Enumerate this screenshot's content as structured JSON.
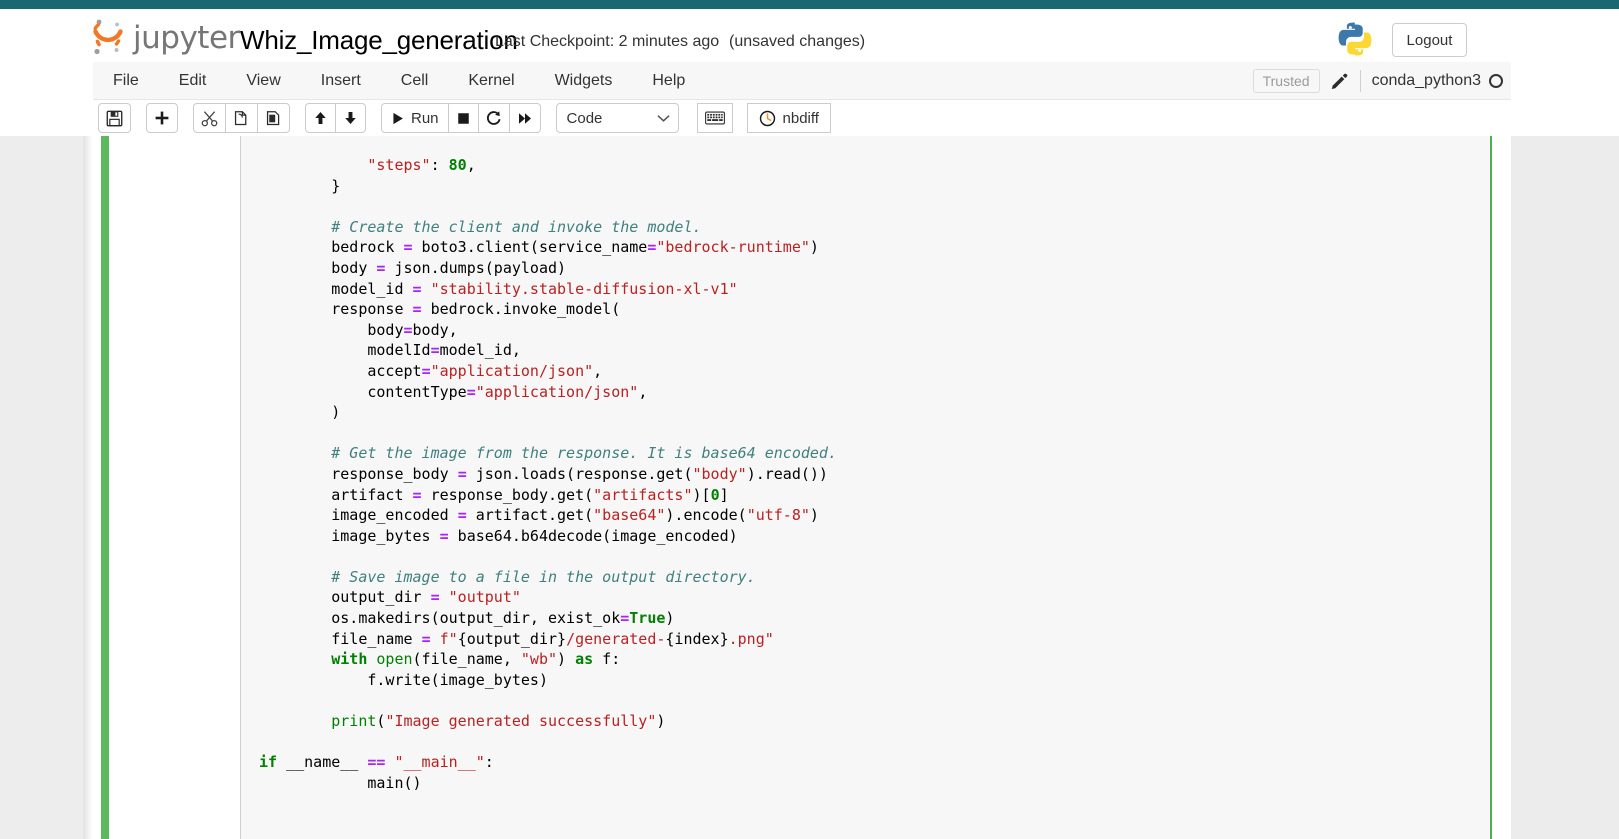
{
  "window": {
    "accent_teal": "#1a6872",
    "cell_select_green": "#5cb85c"
  },
  "header": {
    "logo_word": "jupyter",
    "logo_icon": "jupyter-logo",
    "notebook_title": "Whiz_Image_generation",
    "checkpoint_label": "Last Checkpoint: 2 minutes ago",
    "unsaved_label": "(unsaved changes)",
    "python_logo_icon": "python-logo",
    "logout_label": "Logout"
  },
  "menubar": {
    "items": [
      {
        "label": "File"
      },
      {
        "label": "Edit"
      },
      {
        "label": "View"
      },
      {
        "label": "Insert"
      },
      {
        "label": "Cell"
      },
      {
        "label": "Kernel"
      },
      {
        "label": "Widgets"
      },
      {
        "label": "Help"
      }
    ],
    "trusted_label": "Trusted",
    "edit_icon": "pencil-icon",
    "kernel_name": "conda_python3",
    "kernel_status_icon": "kernel-idle-circle-icon"
  },
  "toolbar": {
    "save_label": "",
    "save_icon": "save-floppy-icon",
    "insert_icon": "plus-icon",
    "cut_icon": "scissors-icon",
    "copy_icon": "copy-icon",
    "paste_icon": "paste-icon",
    "move_up_icon": "arrow-up-icon",
    "move_down_icon": "arrow-down-icon",
    "run_label": "Run",
    "run_icon": "play-icon",
    "stop_icon": "stop-square-icon",
    "restart_icon": "restart-circle-arrow-icon",
    "restart_run_all_icon": "fast-forward-icon",
    "cell_type_value": "Code",
    "cell_type_caret_icon": "chevron-down-icon",
    "keyboard_icon": "keyboard-icon",
    "nbdiff_label": "nbdiff",
    "nbdiff_icon": "clock-icon"
  },
  "notebook": {
    "cell": {
      "type": "code",
      "prompt": "",
      "language": "python",
      "lines": [
        [
          {
            "t": "    ",
            "c": "nm"
          },
          {
            "t": "\"steps\"",
            "c": "str"
          },
          {
            "t": ": ",
            "c": "nm"
          },
          {
            "t": "80",
            "c": "num"
          },
          {
            "t": ",",
            "c": "nm"
          }
        ],
        [
          {
            "t": "}",
            "c": "nm"
          }
        ],
        [
          {
            "t": "",
            "c": "nm"
          }
        ],
        [
          {
            "t": "# Create the client and invoke the model.",
            "c": "com"
          }
        ],
        [
          {
            "t": "bedrock ",
            "c": "nm"
          },
          {
            "t": "=",
            "c": "op"
          },
          {
            "t": " boto3.client(service_name",
            "c": "nm"
          },
          {
            "t": "=",
            "c": "op"
          },
          {
            "t": "\"bedrock-runtime\"",
            "c": "str"
          },
          {
            "t": ")",
            "c": "nm"
          }
        ],
        [
          {
            "t": "body ",
            "c": "nm"
          },
          {
            "t": "=",
            "c": "op"
          },
          {
            "t": " json.dumps(payload)",
            "c": "nm"
          }
        ],
        [
          {
            "t": "model_id ",
            "c": "nm"
          },
          {
            "t": "=",
            "c": "op"
          },
          {
            "t": " ",
            "c": "nm"
          },
          {
            "t": "\"stability.stable-diffusion-xl-v1\"",
            "c": "str"
          }
        ],
        [
          {
            "t": "response ",
            "c": "nm"
          },
          {
            "t": "=",
            "c": "op"
          },
          {
            "t": " bedrock.invoke_model(",
            "c": "nm"
          }
        ],
        [
          {
            "t": "    body",
            "c": "nm"
          },
          {
            "t": "=",
            "c": "op"
          },
          {
            "t": "body,",
            "c": "nm"
          }
        ],
        [
          {
            "t": "    modelId",
            "c": "nm"
          },
          {
            "t": "=",
            "c": "op"
          },
          {
            "t": "model_id,",
            "c": "nm"
          }
        ],
        [
          {
            "t": "    accept",
            "c": "nm"
          },
          {
            "t": "=",
            "c": "op"
          },
          {
            "t": "\"application/json\"",
            "c": "str"
          },
          {
            "t": ",",
            "c": "nm"
          }
        ],
        [
          {
            "t": "    contentType",
            "c": "nm"
          },
          {
            "t": "=",
            "c": "op"
          },
          {
            "t": "\"application/json\"",
            "c": "str"
          },
          {
            "t": ",",
            "c": "nm"
          }
        ],
        [
          {
            "t": ")",
            "c": "nm"
          }
        ],
        [
          {
            "t": "",
            "c": "nm"
          }
        ],
        [
          {
            "t": "# Get the image from the response. It is base64 encoded.",
            "c": "com"
          }
        ],
        [
          {
            "t": "response_body ",
            "c": "nm"
          },
          {
            "t": "=",
            "c": "op"
          },
          {
            "t": " json.loads(response.get(",
            "c": "nm"
          },
          {
            "t": "\"body\"",
            "c": "str"
          },
          {
            "t": ").read())",
            "c": "nm"
          }
        ],
        [
          {
            "t": "artifact ",
            "c": "nm"
          },
          {
            "t": "=",
            "c": "op"
          },
          {
            "t": " response_body.get(",
            "c": "nm"
          },
          {
            "t": "\"artifacts\"",
            "c": "str"
          },
          {
            "t": ")[",
            "c": "nm"
          },
          {
            "t": "0",
            "c": "num"
          },
          {
            "t": "]",
            "c": "nm"
          }
        ],
        [
          {
            "t": "image_encoded ",
            "c": "nm"
          },
          {
            "t": "=",
            "c": "op"
          },
          {
            "t": " artifact.get(",
            "c": "nm"
          },
          {
            "t": "\"base64\"",
            "c": "str"
          },
          {
            "t": ").encode(",
            "c": "nm"
          },
          {
            "t": "\"utf-8\"",
            "c": "str"
          },
          {
            "t": ")",
            "c": "nm"
          }
        ],
        [
          {
            "t": "image_bytes ",
            "c": "nm"
          },
          {
            "t": "=",
            "c": "op"
          },
          {
            "t": " base64.b64decode(image_encoded)",
            "c": "nm"
          }
        ],
        [
          {
            "t": "",
            "c": "nm"
          }
        ],
        [
          {
            "t": "# Save image to a file in the output directory.",
            "c": "com"
          }
        ],
        [
          {
            "t": "output_dir ",
            "c": "nm"
          },
          {
            "t": "=",
            "c": "op"
          },
          {
            "t": " ",
            "c": "nm"
          },
          {
            "t": "\"output\"",
            "c": "str"
          }
        ],
        [
          {
            "t": "os.makedirs(output_dir, exist_ok",
            "c": "nm"
          },
          {
            "t": "=",
            "c": "op"
          },
          {
            "t": "True",
            "c": "kw"
          },
          {
            "t": ")",
            "c": "nm"
          }
        ],
        [
          {
            "t": "file_name ",
            "c": "nm"
          },
          {
            "t": "=",
            "c": "op"
          },
          {
            "t": " ",
            "c": "nm"
          },
          {
            "t": "f\"",
            "c": "str"
          },
          {
            "t": "{output_dir}",
            "c": "nm"
          },
          {
            "t": "/generated-",
            "c": "str"
          },
          {
            "t": "{index}",
            "c": "nm"
          },
          {
            "t": ".png\"",
            "c": "str"
          }
        ],
        [
          {
            "t": "with",
            "c": "kw"
          },
          {
            "t": " ",
            "c": "nm"
          },
          {
            "t": "open",
            "c": "bi"
          },
          {
            "t": "(file_name, ",
            "c": "nm"
          },
          {
            "t": "\"wb\"",
            "c": "str"
          },
          {
            "t": ") ",
            "c": "nm"
          },
          {
            "t": "as",
            "c": "kw"
          },
          {
            "t": " f:",
            "c": "nm"
          }
        ],
        [
          {
            "t": "    f.write(image_bytes)",
            "c": "nm"
          }
        ],
        [
          {
            "t": "",
            "c": "nm"
          }
        ],
        [
          {
            "t": "print",
            "c": "bi"
          },
          {
            "t": "(",
            "c": "nm"
          },
          {
            "t": "\"Image generated successfully\"",
            "c": "str"
          },
          {
            "t": ")",
            "c": "nm"
          }
        ],
        [
          {
            "t": "",
            "c": "nm"
          }
        ],
        [
          {
            "t": "INDENT_OUT",
            "c": "marker"
          }
        ],
        [
          {
            "t": "    main()",
            "c": "nm"
          }
        ]
      ],
      "dedent_line": [
        {
          "t": "if",
          "c": "kw"
        },
        {
          "t": " __name__ ",
          "c": "nm"
        },
        {
          "t": "==",
          "c": "op"
        },
        {
          "t": " ",
          "c": "nm"
        },
        {
          "t": "\"__main__\"",
          "c": "str"
        },
        {
          "t": ":",
          "c": "nm"
        }
      ]
    }
  }
}
